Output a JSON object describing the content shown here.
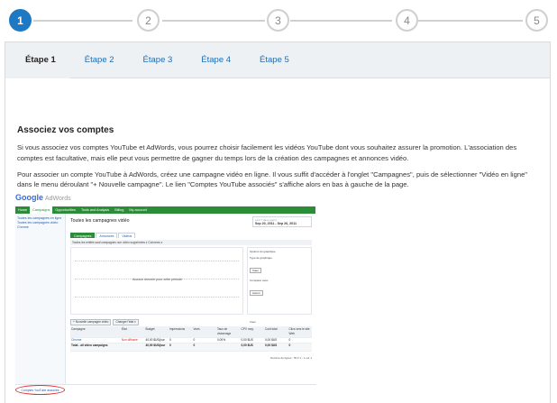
{
  "stepper": {
    "steps": [
      "1",
      "2",
      "3",
      "4",
      "5"
    ],
    "active_index": 0,
    "accent_color": "#1e79c4"
  },
  "tabs": [
    "Étape 1",
    "Étape 2",
    "Étape 3",
    "Étape 4",
    "Étape 5"
  ],
  "content": {
    "heading": "Associez vos comptes",
    "paragraph1": "Si vous associez vos comptes YouTube et AdWords, vous pourrez choisir facilement les vidéos YouTube dont vous souhaitez assurer la promotion. L'association des comptes est facultative, mais elle peut vous permettre de gagner du temps lors de la création des campagnes et annonces vidéo.",
    "paragraph2": "Pour associer un compte YouTube à AdWords, créez une campagne vidéo en ligne. Il vous suffit d'accéder à l'onglet \"Campagnes\", puis de sélectionner \"Vidéo en ligne\" dans le menu déroulant \"+ Nouvelle campagne\". Le lien \"Comptes YouTube associés\" s'affiche alors en bas à gauche de la page."
  },
  "screenshot": {
    "logo": "Google",
    "logo_suffix": "AdWords",
    "nav": [
      "Home",
      "Campaigns",
      "Opportunities",
      "Tools and Analysis",
      "Billing",
      "My account"
    ],
    "nav_active": 1,
    "sidebar": [
      "Toutes les campagnes en ligne",
      "Toutes les campagnes vidéo",
      "Chrome"
    ],
    "title": "Toutes les campagnes vidéo",
    "date_label": "Last 7 days (gem)",
    "date_range": "Sep 20, 2011 - Sep 26, 2011",
    "inner_tabs": [
      "Campagnes",
      "Annonces",
      "Vidéos"
    ],
    "filter_text": "Toutes les entités sauf campagnes non vidéo supprimées ▾   Colonnes ▾",
    "chart_message": "Aucune donnée pour cette période",
    "options": {
      "title": "Options du graphique",
      "type_label": "Type de graphique",
      "type_value": "Vues",
      "compare_label": "Comparer avec",
      "aucun": "Aucun",
      "views": "Vues"
    },
    "buttons": [
      "+ Nouvelle campagne vidéo",
      "Changer l'état ▾"
    ],
    "table_headers": [
      "Campagne",
      "État",
      "Budget",
      "Impressions",
      "Vues",
      "Taux de visionnage",
      "CPV moy.",
      "Coût total",
      "Clics vers le site Web"
    ],
    "table_row": [
      "Chrome",
      "Non diffusée",
      "40,00 $US/jour",
      "0",
      "0",
      "0,00%",
      "0,00 $US",
      "0,00 $US",
      "0"
    ],
    "table_total": [
      "Total - all video campaigns",
      "",
      "40,00 $US/jour",
      "0",
      "0",
      "",
      "0,00 $US",
      "0,00 $US",
      "0"
    ],
    "pager": "Nombre de lignes : 50 ▾  1 - 1 sur 1",
    "linked_accounts_link": "Comptes YouTube associés",
    "highlight_color": "#e0302f"
  }
}
